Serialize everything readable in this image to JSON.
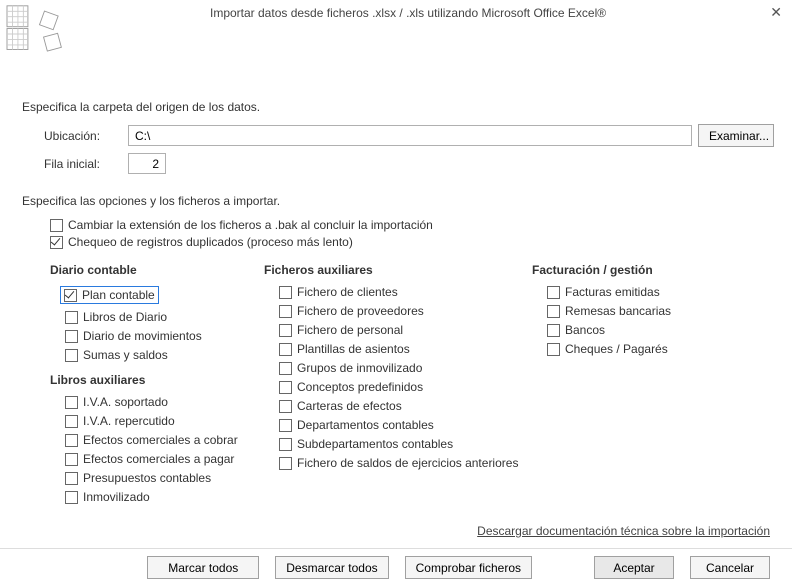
{
  "window": {
    "title": "Importar datos desde ficheros .xlsx / .xls utilizando Microsoft Office Excel®"
  },
  "section1": {
    "heading": "Especifica la carpeta del origen de los datos.",
    "loc_label": "Ubicación:",
    "loc_value": "C:\\",
    "browse": "Examinar...",
    "row_label": "Fila inicial:",
    "row_value": "2"
  },
  "section2": {
    "heading": "Especifica las opciones y los ficheros a importar.",
    "opt_bak": "Cambiar la extensión de los ficheros a .bak al concluir la importación",
    "opt_dup": "Chequeo de registros duplicados (proceso más lento)"
  },
  "colA": {
    "head1": "Diario contable",
    "items1": [
      "Plan contable",
      "Libros de Diario",
      "Diario de movimientos",
      "Sumas y saldos"
    ],
    "head2": "Libros auxiliares",
    "items2": [
      "I.V.A. soportado",
      "I.V.A. repercutido",
      "Efectos comerciales a cobrar",
      "Efectos comerciales a pagar",
      "Presupuestos contables",
      "Inmovilizado"
    ]
  },
  "colB": {
    "head": "Ficheros auxiliares",
    "items": [
      "Fichero de clientes",
      "Fichero de proveedores",
      "Fichero de personal",
      "Plantillas de asientos",
      "Grupos de inmovilizado",
      "Conceptos predefinidos",
      "Carteras de efectos",
      "Departamentos contables",
      "Subdepartamentos contables",
      "Fichero de saldos de ejercicios anteriores"
    ]
  },
  "colC": {
    "head": "Facturación / gestión",
    "items": [
      "Facturas emitidas",
      "Remesas bancarias",
      "Bancos",
      "Cheques / Pagarés"
    ]
  },
  "link": "Descargar documentación técnica sobre la importación",
  "footer": {
    "mark_all": "Marcar todos",
    "unmark_all": "Desmarcar todos",
    "check_files": "Comprobar ficheros",
    "accept": "Aceptar",
    "cancel": "Cancelar"
  }
}
